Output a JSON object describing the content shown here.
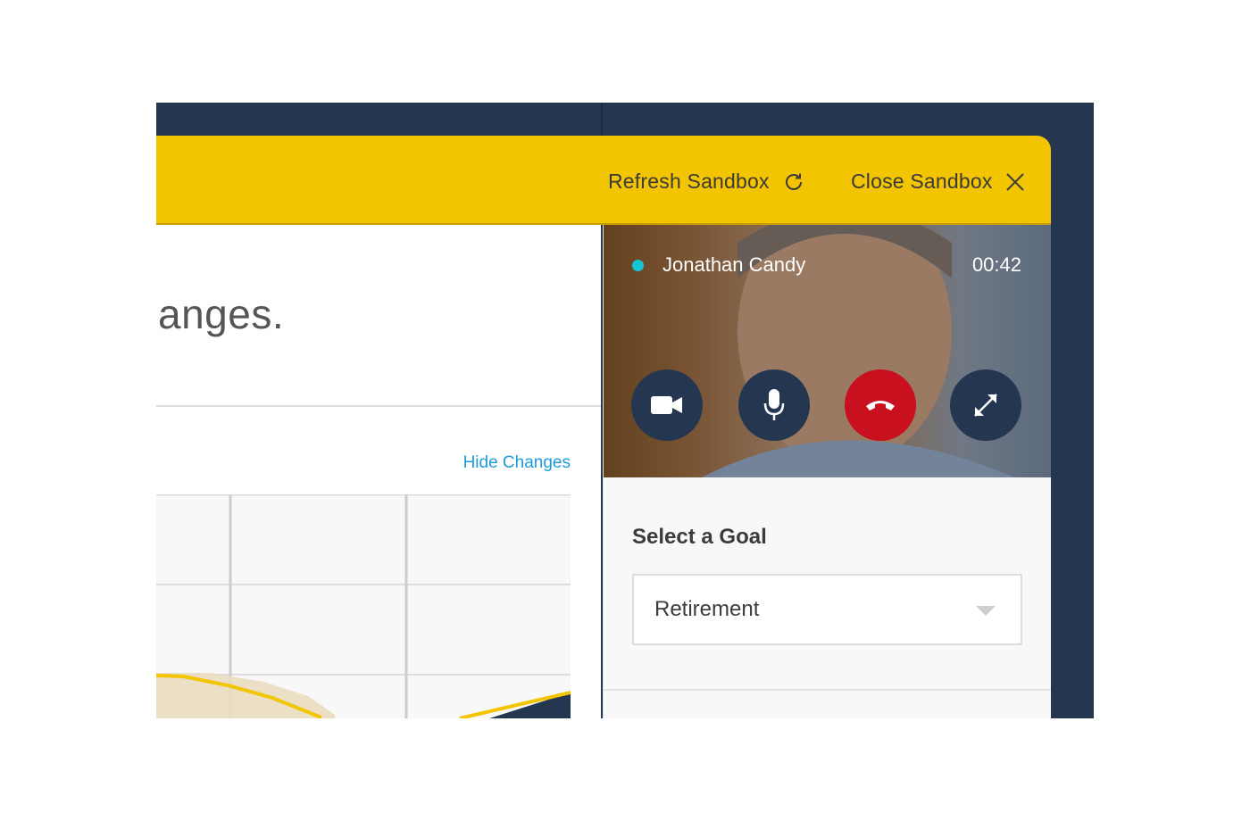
{
  "toolbar": {
    "refresh_label": "Refresh Sandbox",
    "refresh_icon": "refresh-icon",
    "close_label": "Close Sandbox",
    "close_icon": "close-icon"
  },
  "main": {
    "headline": "anges.",
    "hide_changes_label": "Hide Changes"
  },
  "call": {
    "caller_name": "Jonathan Candy",
    "status": "online",
    "duration": "00:42",
    "controls": [
      "video-camera-icon",
      "microphone-icon",
      "hang-up-icon",
      "expand-icon"
    ]
  },
  "goal": {
    "label": "Select a Goal",
    "selected": "Retirement"
  },
  "colors": {
    "frame": "#243650",
    "accent_yellow": "#f2c500",
    "link_blue": "#1e9bd7",
    "hangup_red": "#c8101e",
    "status_teal": "#18c3d4"
  }
}
